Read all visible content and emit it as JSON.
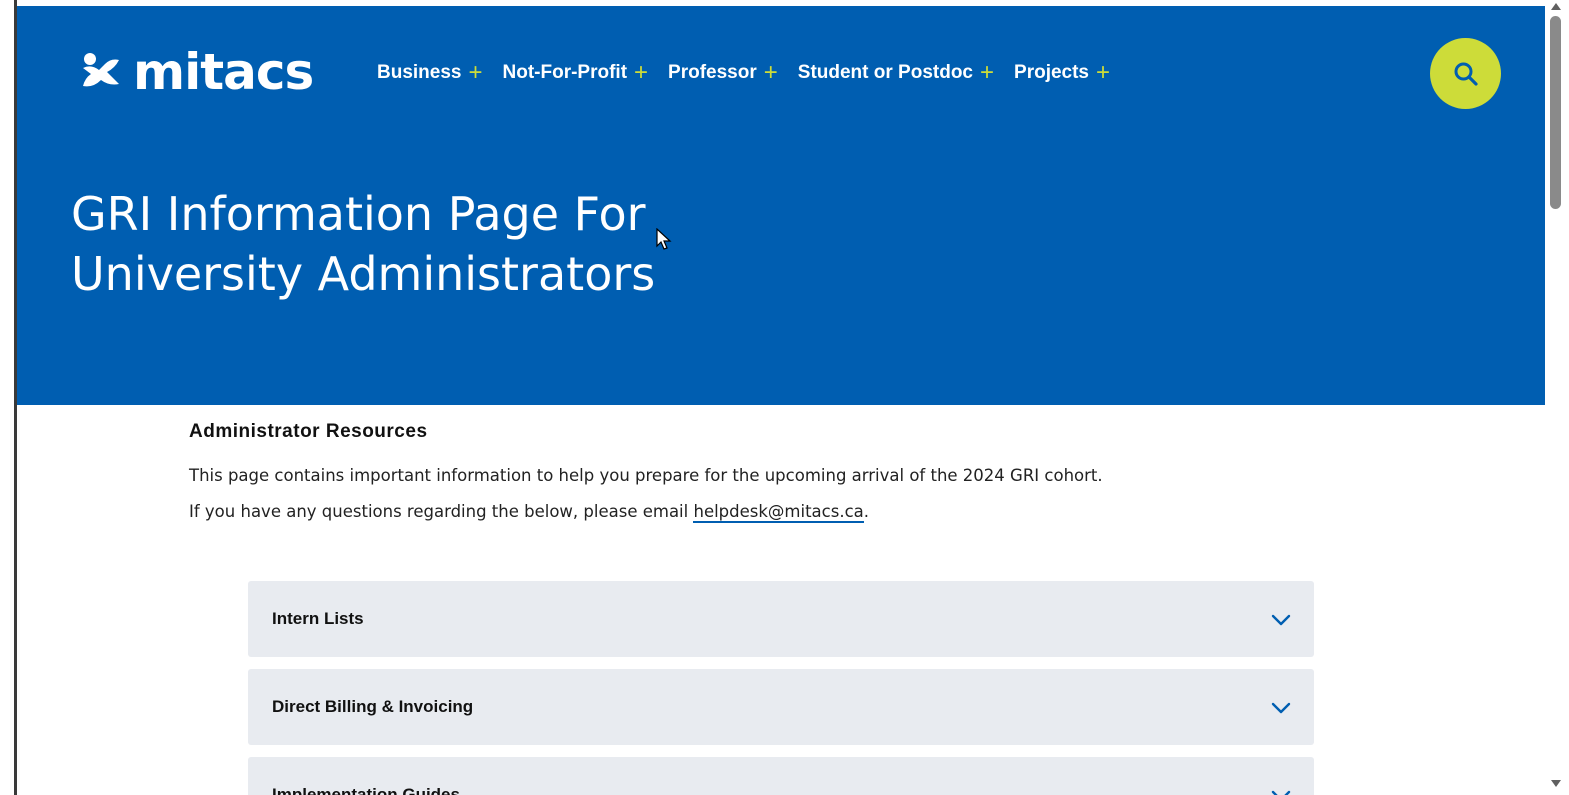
{
  "site": {
    "logo_text": "mitacs"
  },
  "nav": {
    "items": [
      {
        "label": "Business"
      },
      {
        "label": "Not-For-Profit"
      },
      {
        "label": "Professor"
      },
      {
        "label": "Student or Postdoc"
      },
      {
        "label": "Projects"
      }
    ],
    "plus_symbol": "+"
  },
  "hero": {
    "title_line1": "GRI Information Page For",
    "title_line2": "University Administrators"
  },
  "content": {
    "heading": "Administrator Resources",
    "intro": "This page contains important information to help you prepare for the upcoming arrival of the 2024 GRI cohort.",
    "contact_prefix": "If you have any questions regarding the below, please email ",
    "contact_email": "helpdesk@mitacs.ca",
    "contact_suffix": "."
  },
  "accordions": [
    {
      "label": "Intern Lists"
    },
    {
      "label": "Direct Billing & Invoicing"
    },
    {
      "label": "Implementation Guides"
    }
  ],
  "colors": {
    "brand_blue": "#005eb1",
    "accent_lime": "#cddc39",
    "panel_grey": "#e8ebf0"
  },
  "icons": {
    "search": "search-icon",
    "chevron": "chevron-down-icon",
    "logo_mark": "mitacs-logo-mark"
  }
}
